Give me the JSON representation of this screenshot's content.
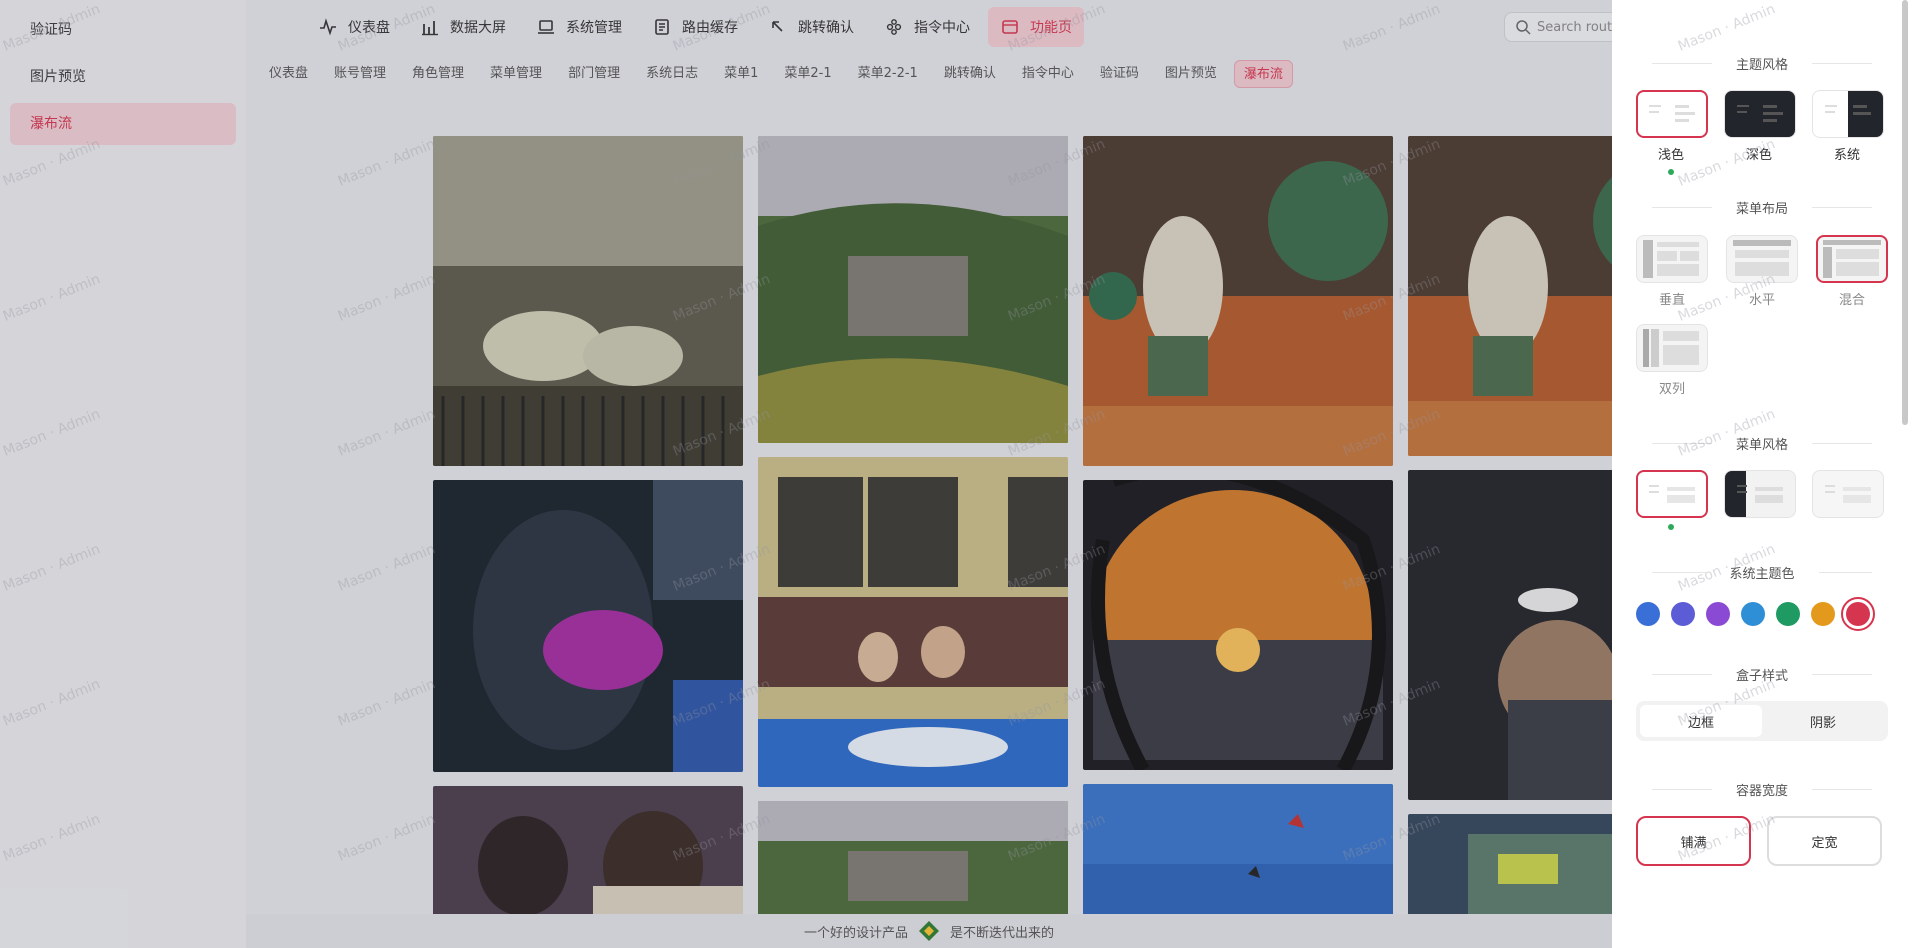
{
  "sidebar": {
    "items": [
      {
        "label": "验证码"
      },
      {
        "label": "图片预览"
      },
      {
        "label": "瀑布流"
      }
    ]
  },
  "topnav": {
    "items": [
      {
        "label": "仪表盘",
        "icon": "pulse-icon"
      },
      {
        "label": "数据大屏",
        "icon": "bar-chart-icon"
      },
      {
        "label": "系统管理",
        "icon": "laptop-icon"
      },
      {
        "label": "路由缓存",
        "icon": "document-icon"
      },
      {
        "label": "跳转确认",
        "icon": "arrow-up-left-icon"
      },
      {
        "label": "指令中心",
        "icon": "gamepad-icon"
      },
      {
        "label": "功能页",
        "icon": "layout-icon"
      }
    ],
    "search_placeholder": "Search route"
  },
  "tabs": [
    "仪表盘",
    "账号管理",
    "角色管理",
    "菜单管理",
    "部门管理",
    "系统日志",
    "菜单1",
    "菜单2-1",
    "菜单2-2-1",
    "跳转确认",
    "指令中心",
    "验证码",
    "图片预览",
    "瀑布流"
  ],
  "footer": {
    "left": "一个好的设计产品",
    "right": "是不断迭代出来的"
  },
  "watermark": "Mason · Admin",
  "settings": {
    "theme_title": "主题风格",
    "themes": [
      {
        "label": "浅色"
      },
      {
        "label": "深色"
      },
      {
        "label": "系统"
      }
    ],
    "layout_title": "菜单布局",
    "layouts": [
      {
        "label": "垂直"
      },
      {
        "label": "水平"
      },
      {
        "label": "混合"
      },
      {
        "label": "双列"
      }
    ],
    "menu_style_title": "菜单风格",
    "color_title": "系统主题色",
    "colors": [
      "#3b6fd8",
      "#5b5cd6",
      "#8b4ad3",
      "#2f8fd6",
      "#1f9a62",
      "#e39a1c",
      "#d5354e"
    ],
    "box_title": "盒子样式",
    "box_options": [
      "边框",
      "阴影"
    ],
    "width_title": "容器宽度",
    "width_options": [
      "铺满",
      "定宽"
    ]
  }
}
